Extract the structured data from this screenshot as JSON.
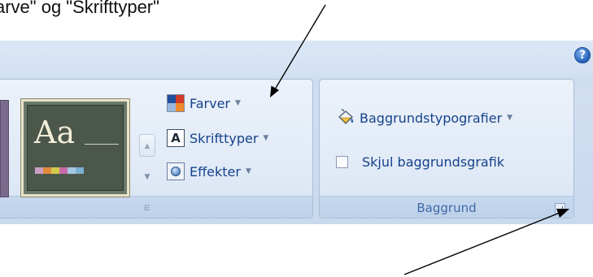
{
  "caption": "arve\" og \"Skrifttyper\"",
  "help_button": {
    "label": "?"
  },
  "theme_thumbnail": {
    "text": "Aa",
    "swatches": [
      "#c9a0c4",
      "#e08a3c",
      "#d2c84a",
      "#c96aa8",
      "#a6c7e0",
      "#7bb0d0"
    ]
  },
  "theme_scroll": {
    "up": "▲",
    "down": "▼",
    "more": "⋿"
  },
  "theme_commands": [
    {
      "label": "Farver",
      "caret": "▼",
      "icon": "theme-colors-icon"
    },
    {
      "label": "Skrifttyper",
      "caret": "▼",
      "icon": "theme-fonts-icon",
      "icon_letter": "A"
    },
    {
      "label": "Effekter",
      "caret": "▼",
      "icon": "theme-effects-icon"
    }
  ],
  "background_group": {
    "styles_label": "Baggrundstypografier",
    "styles_caret": "▼",
    "styles_icon": "paint-bucket-icon",
    "hide_graphics_label": "Skjul baggrundsgrafik",
    "hide_graphics_checked": false,
    "title": "Baggrund"
  }
}
